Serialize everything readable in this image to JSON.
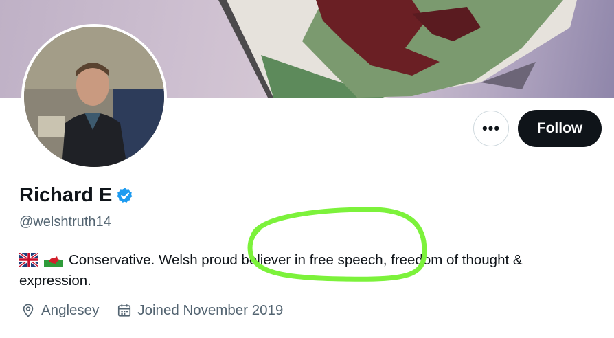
{
  "profile": {
    "name": "Richard E",
    "handle": "@welshtruth14",
    "bio_flags": [
      "uk-flag-icon",
      "wales-flag-icon"
    ],
    "bio_text": "Conservative. Welsh proud believer in free speech, freedom of thought & expression.",
    "location": "Anglesey",
    "joined": "Joined November 2019"
  },
  "actions": {
    "more_label": "•••",
    "follow_label": "Follow"
  },
  "colors": {
    "follow_bg": "#0f1419",
    "verified_blue": "#1d9bf0",
    "secondary_text": "#536471",
    "annotation_green": "#7cf23b"
  }
}
